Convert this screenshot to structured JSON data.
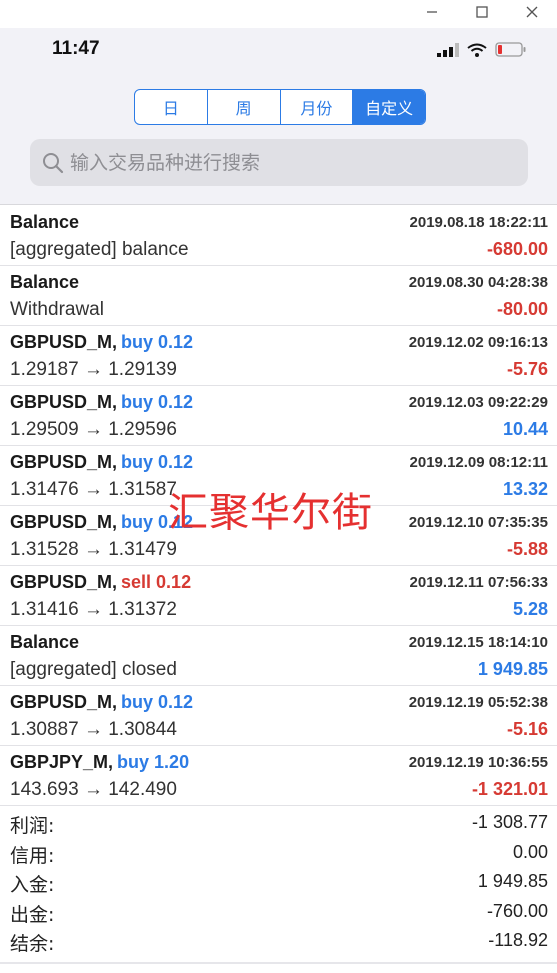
{
  "status": {
    "time": "11:47"
  },
  "tabs": [
    {
      "label": "日",
      "active": false
    },
    {
      "label": "周",
      "active": false
    },
    {
      "label": "月份",
      "active": false
    },
    {
      "label": "自定义",
      "active": true
    }
  ],
  "search": {
    "placeholder": "输入交易品种进行搜索"
  },
  "history": [
    {
      "symbol": "Balance",
      "action": "",
      "action_type": "",
      "date": "2019.08.18 18:22:11",
      "desc": "[aggregated] balance",
      "value": "-680.00",
      "sign": "neg"
    },
    {
      "symbol": "Balance",
      "action": "",
      "action_type": "",
      "date": "2019.08.30 04:28:38",
      "desc": "Withdrawal",
      "value": "-80.00",
      "sign": "neg"
    },
    {
      "symbol": "GBPUSD_M,",
      "action": "buy 0.12",
      "action_type": "buy",
      "date": "2019.12.02 09:16:13",
      "desc": "1.29187 → 1.29139",
      "value": "-5.76",
      "sign": "neg"
    },
    {
      "symbol": "GBPUSD_M,",
      "action": "buy 0.12",
      "action_type": "buy",
      "date": "2019.12.03 09:22:29",
      "desc": "1.29509 → 1.29596",
      "value": "10.44",
      "sign": "pos"
    },
    {
      "symbol": "GBPUSD_M,",
      "action": "buy 0.12",
      "action_type": "buy",
      "date": "2019.12.09 08:12:11",
      "desc": "1.31476 → 1.31587",
      "value": "13.32",
      "sign": "pos"
    },
    {
      "symbol": "GBPUSD_M,",
      "action": "buy 0.12",
      "action_type": "buy",
      "date": "2019.12.10 07:35:35",
      "desc": "1.31528 → 1.31479",
      "value": "-5.88",
      "sign": "neg"
    },
    {
      "symbol": "GBPUSD_M,",
      "action": "sell 0.12",
      "action_type": "sell",
      "date": "2019.12.11 07:56:33",
      "desc": "1.31416 → 1.31372",
      "value": "5.28",
      "sign": "pos"
    },
    {
      "symbol": "Balance",
      "action": "",
      "action_type": "",
      "date": "2019.12.15 18:14:10",
      "desc": "[aggregated] closed",
      "value": "1 949.85",
      "sign": "pos"
    },
    {
      "symbol": "GBPUSD_M,",
      "action": "buy 0.12",
      "action_type": "buy",
      "date": "2019.12.19 05:52:38",
      "desc": "1.30887 → 1.30844",
      "value": "-5.16",
      "sign": "neg"
    },
    {
      "symbol": "GBPJPY_M,",
      "action": "buy 1.20",
      "action_type": "buy",
      "date": "2019.12.19 10:36:55",
      "desc": "143.693 → 142.490",
      "value": "-1 321.01",
      "sign": "neg"
    }
  ],
  "summary": [
    {
      "label": "利润:",
      "value": "-1 308.77"
    },
    {
      "label": "信用:",
      "value": "0.00"
    },
    {
      "label": "入金:",
      "value": "1 949.85"
    },
    {
      "label": "出金:",
      "value": "-760.00"
    },
    {
      "label": "结余:",
      "value": "-118.92"
    }
  ],
  "watermark": "汇聚华尔街",
  "colors": {
    "accent": "#2c7be5",
    "negative": "#d63a33",
    "positive": "#2c7be5",
    "header_bg": "#f2f2f7"
  }
}
